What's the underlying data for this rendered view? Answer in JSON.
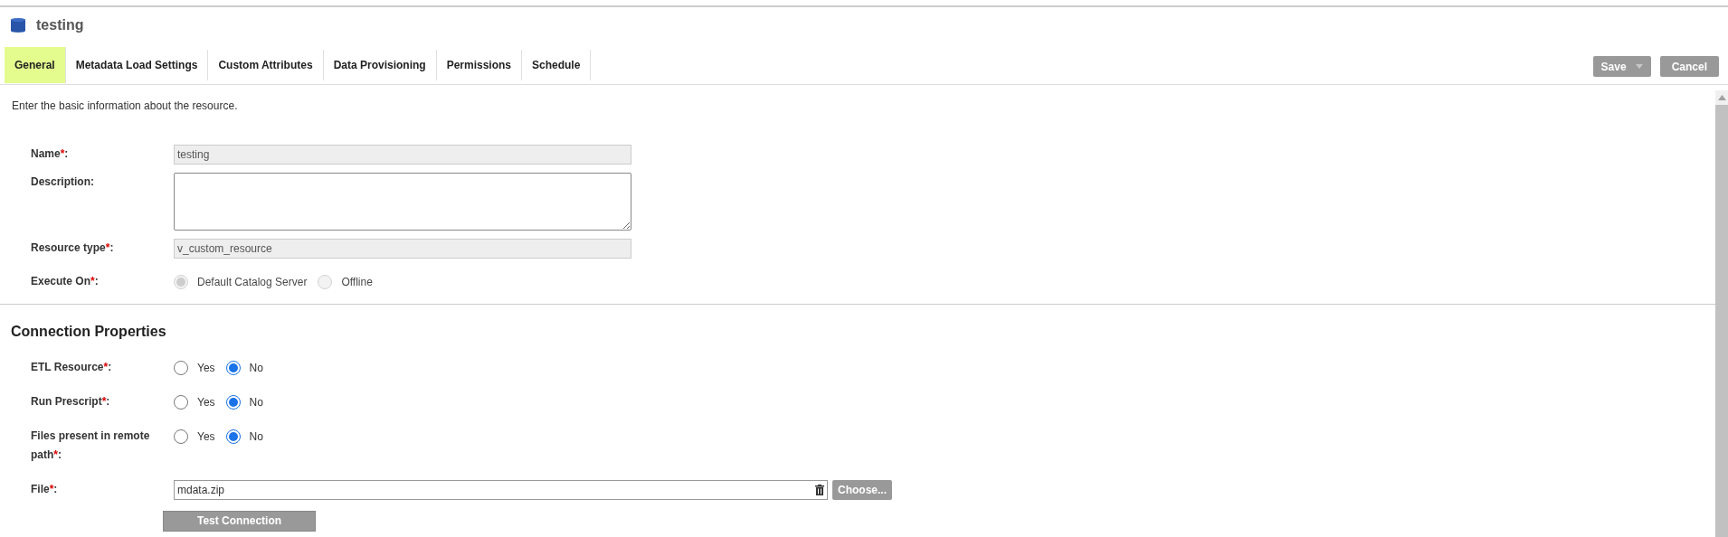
{
  "title": "testing",
  "tabs": [
    {
      "label": "General",
      "selected": true
    },
    {
      "label": "Metadata Load Settings",
      "selected": false
    },
    {
      "label": "Custom Attributes",
      "selected": false
    },
    {
      "label": "Data Provisioning",
      "selected": false
    },
    {
      "label": "Permissions",
      "selected": false
    },
    {
      "label": "Schedule",
      "selected": false
    }
  ],
  "actions": [
    {
      "label": "Save",
      "kind": "split"
    },
    {
      "label": "Cancel",
      "kind": "plain"
    }
  ],
  "intro": "Enter the basic information about the resource.",
  "general_fields": [
    {
      "label": "Name",
      "mark": "*",
      "suffix": ":",
      "kind": "readonly",
      "value": "testing"
    },
    {
      "label": "Description",
      "suffix": ":",
      "kind": "textarea"
    },
    {
      "label": "Resource type",
      "mark": "*",
      "suffix": ":",
      "kind": "readonly",
      "value": "v_custom_resource"
    },
    {
      "label": "Execute On",
      "mark": "*",
      "suffix": ":",
      "kind": "radio",
      "disabled": true,
      "options": [
        {
          "label": "Default Catalog Server",
          "selected": true
        },
        {
          "label": "Offline",
          "selected": false
        }
      ]
    }
  ],
  "connection": {
    "heading": "Connection Properties",
    "fields": [
      {
        "label": "ETL Resource",
        "mark": "*",
        "suffix": ":",
        "kind": "radio",
        "disabled": false,
        "options": [
          {
            "label": "Yes",
            "selected": false
          },
          {
            "label": "No",
            "selected": true
          }
        ]
      },
      {
        "label": "Run Prescript",
        "mark": "*",
        "suffix": ":",
        "kind": "radio",
        "disabled": false,
        "options": [
          {
            "label": "Yes",
            "selected": false
          },
          {
            "label": "No",
            "selected": true
          }
        ]
      },
      {
        "label": "Files present in remote path",
        "mark": "*",
        "suffix": ":",
        "kind": "radio",
        "disabled": false,
        "options": [
          {
            "label": "Yes",
            "selected": false
          },
          {
            "label": "No",
            "selected": true
          }
        ]
      },
      {
        "label": "File",
        "mark": "*",
        "suffix": ":",
        "kind": "file",
        "value": "mdata.zip",
        "button": "Choose..."
      }
    ],
    "test_button": "Test Connection"
  }
}
